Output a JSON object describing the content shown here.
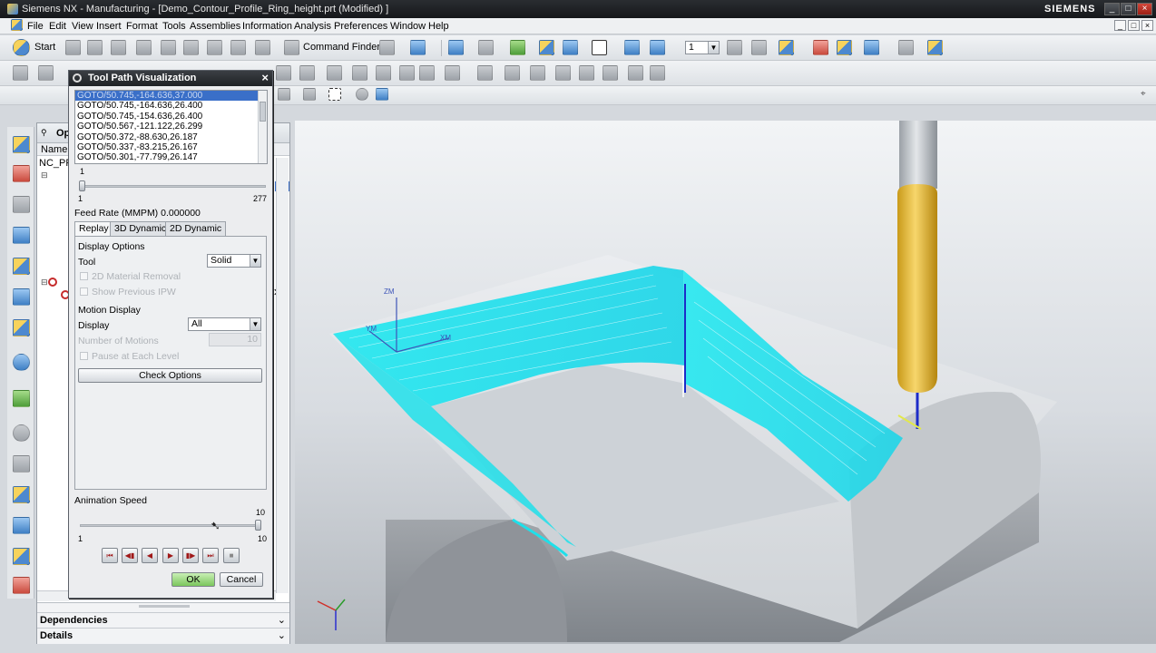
{
  "window": {
    "title": "Siemens NX - Manufacturing - [Demo_Contour_Profile_Ring_height.prt (Modified) ]",
    "brand": "SIEMENS",
    "controls": [
      "_",
      "□",
      "×"
    ]
  },
  "menubar": {
    "items": [
      "File",
      "Edit",
      "View",
      "Insert",
      "Format",
      "Tools",
      "Assemblies",
      "Information",
      "Analysis",
      "Preferences",
      "Window",
      "Help"
    ],
    "mnemonics": [
      "F",
      "E",
      "V",
      "I",
      "r",
      "T",
      "A",
      "I",
      "A",
      "P",
      "W",
      "H"
    ]
  },
  "toolbar": {
    "start_label": "Start",
    "command_finder_label": "Command Finder",
    "layer_value": "1"
  },
  "navigator": {
    "header_fragment": "Op",
    "column_name": "Name",
    "root_fragment": "NC_PR",
    "dependencies_label": "Dependencies",
    "details_label": "Details"
  },
  "dialog": {
    "title": "Tool Path Visualization",
    "goto_lines": [
      "GOTO/50.745,-164.636,37.000",
      "GOTO/50.745,-164.636,26.400",
      "GOTO/50.745,-154.636,26.400",
      "GOTO/50.567,-121.122,26.299",
      "GOTO/50.372,-88.630,26.187",
      "GOTO/50.337,-83.215,26.167",
      "GOTO/50.301,-77.799,26.147"
    ],
    "position_value": "1",
    "position_min": "1",
    "position_max": "277",
    "feed_rate_label": "Feed Rate (MMPM) 0.000000",
    "tabs": [
      "Replay",
      "3D Dynamic",
      "2D Dynamic"
    ],
    "active_tab": "Replay",
    "display_options_heading": "Display Options",
    "tool_label": "Tool",
    "tool_value": "Solid",
    "material_removal_label": "2D Material Removal",
    "show_ipw_label": "Show Previous IPW",
    "motion_display_heading": "Motion Display",
    "display_label": "Display",
    "display_value": "All",
    "number_of_motions_label": "Number of Motions",
    "number_of_motions_value": "10",
    "pause_label": "Pause at Each Level",
    "check_options_label": "Check Options",
    "animation_speed_label": "Animation Speed",
    "speed_value": "10",
    "speed_fraction": 1.0,
    "speed_min": "1",
    "speed_max": "10",
    "ok_label": "OK",
    "cancel_label": "Cancel"
  },
  "viewport": {
    "axis_labels": [
      "ZM",
      "YM",
      "XM"
    ]
  },
  "colors": {
    "toolpath": "#18e6ee",
    "tool": "#f2c440",
    "part": "#c9ccd0",
    "selection": "#3a6fc8"
  }
}
